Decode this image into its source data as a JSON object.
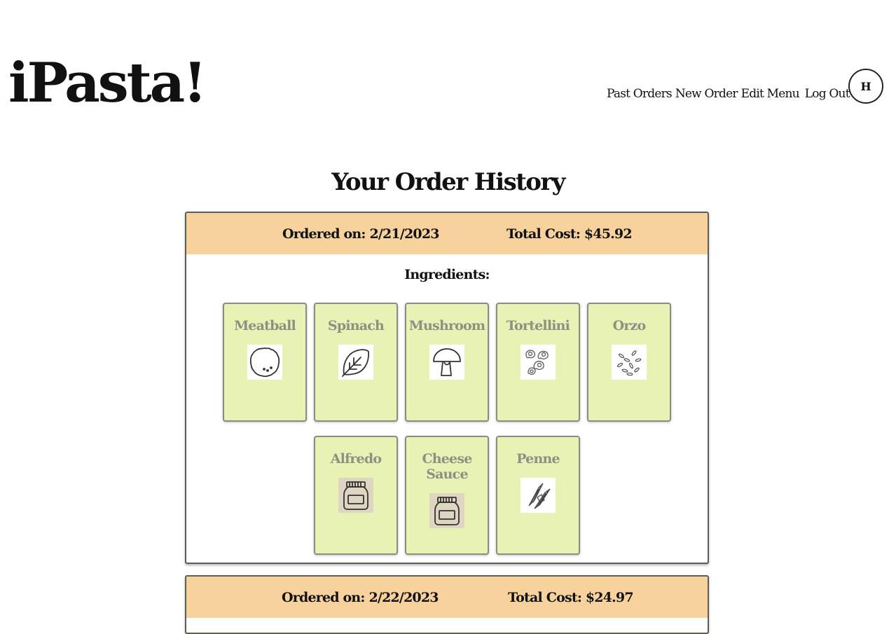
{
  "app": {
    "logo": "iPasta!"
  },
  "nav": {
    "items": [
      "Past Orders",
      "New Order",
      "Edit Menu",
      "Log Out"
    ],
    "avatar_initial": "H"
  },
  "page": {
    "title": "Your Order History"
  },
  "orders": [
    {
      "date_text": "Ordered on: 2/21/2023",
      "cost_text": "Total Cost: $45.92",
      "ingredients_label": "Ingredients:",
      "ingredients": [
        {
          "name": "Meatball",
          "icon": "meatball-icon"
        },
        {
          "name": "Spinach",
          "icon": "spinach-icon"
        },
        {
          "name": "Mushroom",
          "icon": "mushroom-icon"
        },
        {
          "name": "Tortellini",
          "icon": "tortellini-icon"
        },
        {
          "name": "Orzo",
          "icon": "orzo-icon"
        },
        {
          "name": "Alfredo",
          "icon": "sauce-jar-icon"
        },
        {
          "name": "Cheese Sauce",
          "icon": "sauce-jar-icon"
        },
        {
          "name": "Penne",
          "icon": "penne-icon"
        }
      ]
    },
    {
      "date_text": "Ordered on: 2/22/2023",
      "cost_text": "Total Cost: $24.97"
    }
  ],
  "colors": {
    "order_header": "#f7d29d",
    "ingredient_card": "#e8f2b5",
    "ingredient_text": "#8f8f84"
  }
}
